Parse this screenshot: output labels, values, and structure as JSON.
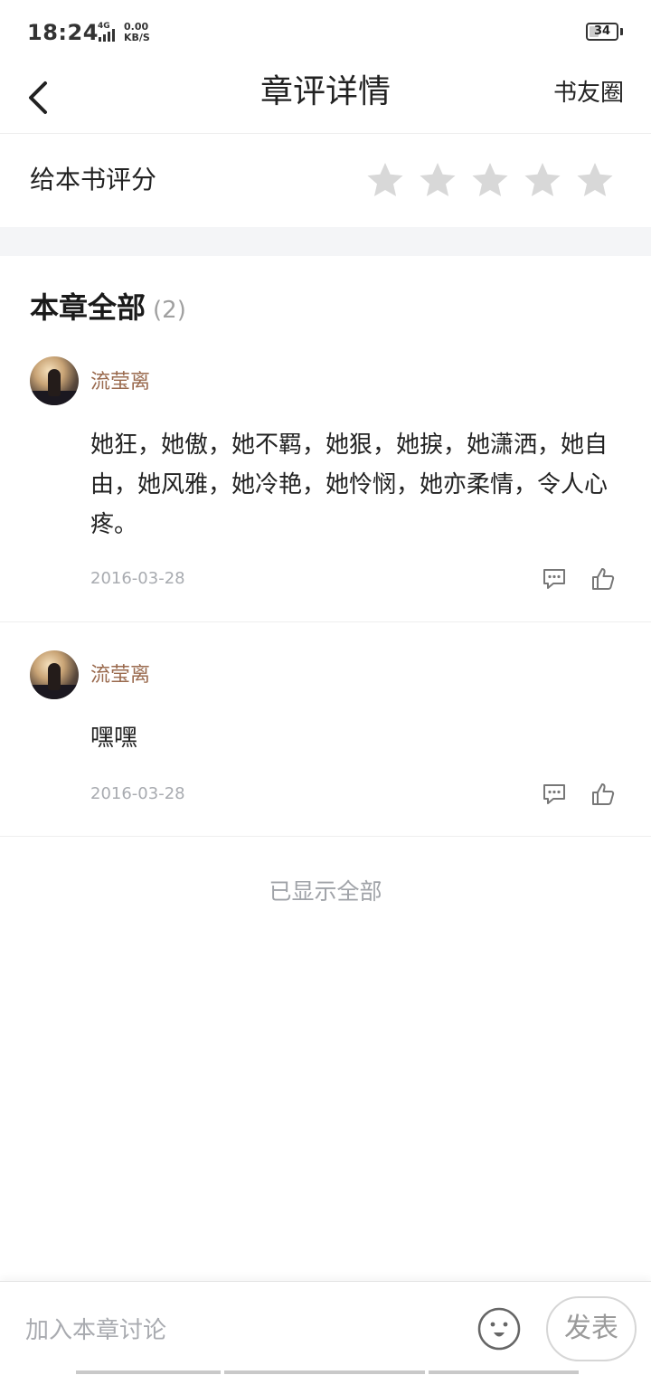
{
  "status_bar": {
    "time": "18:24",
    "network_type": "4G",
    "speed_value": "0.00",
    "speed_unit": "KB/S",
    "battery_level": "34",
    "battery_percent": 34
  },
  "header": {
    "title": "章评详情",
    "right_link": "书友圈",
    "back_icon": "chevron-left-icon"
  },
  "rating": {
    "label": "给本书评分",
    "star_count": 5,
    "selected": 0,
    "star_color": "#d8d8d8"
  },
  "section": {
    "title": "本章全部",
    "count": "(2)"
  },
  "comments": [
    {
      "username": "流莹离",
      "text": "她狂，她傲，她不羁，她狠，她捩，她潇洒，她自由，她风雅，她冷艳，她怜悯，她亦柔情，令人心疼。",
      "date": "2016-03-28",
      "reply_icon": "comment-icon",
      "like_icon": "thumbs-up-icon"
    },
    {
      "username": "流莹离",
      "text": "嘿嘿",
      "date": "2016-03-28",
      "reply_icon": "comment-icon",
      "like_icon": "thumbs-up-icon"
    }
  ],
  "list_end": "已显示全部",
  "bottom_bar": {
    "placeholder": "加入本章讨论",
    "emoji_icon": "emoji-icon",
    "publish_label": "发表"
  },
  "colors": {
    "username": "#9a6a4e",
    "muted": "#a8abb0",
    "section_gap": "#f4f5f7"
  }
}
